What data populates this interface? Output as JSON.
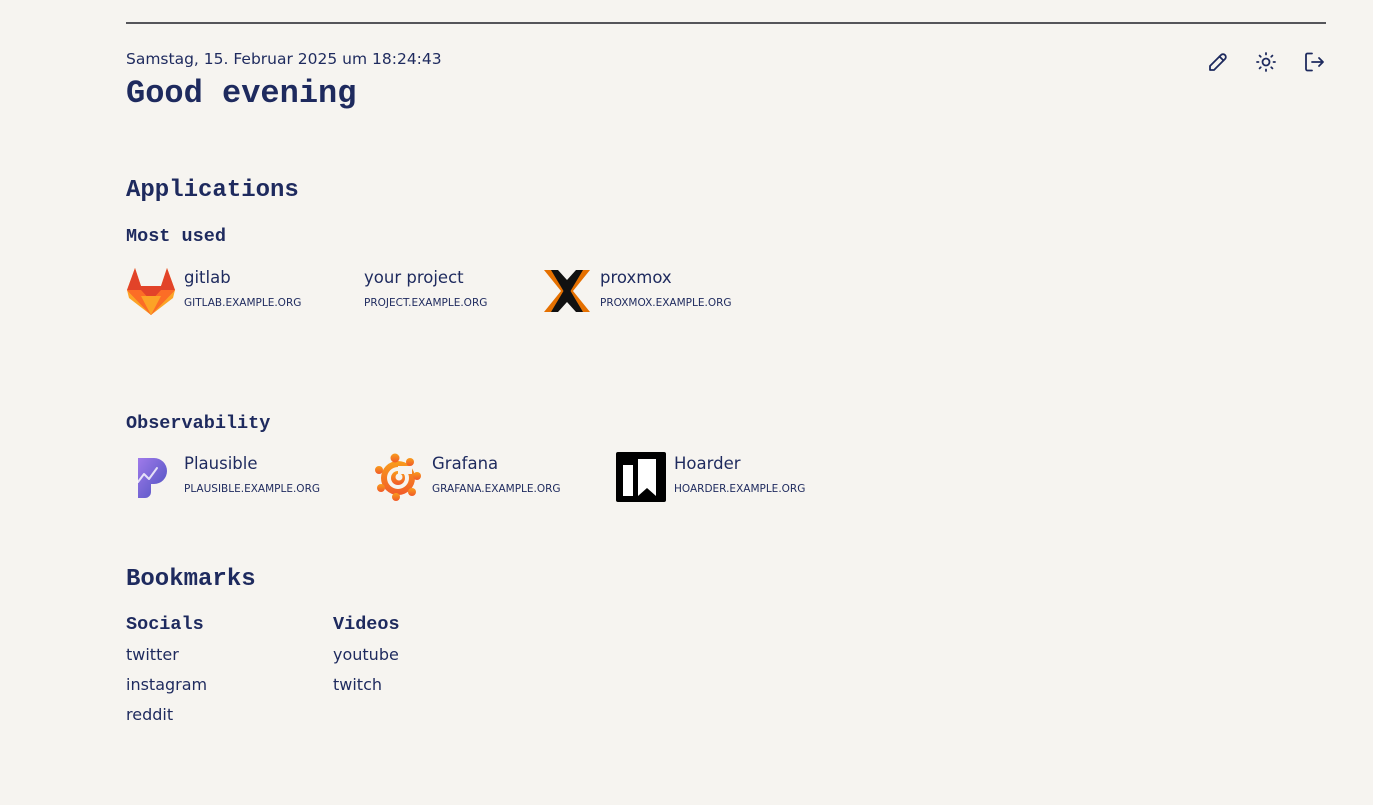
{
  "header": {
    "datetime": "Samstag, 15. Februar 2025 um 18:24:43",
    "greeting": "Good evening",
    "toolbar": {
      "edit_icon": "pencil-icon",
      "theme_icon": "sun-icon",
      "logout_icon": "logout-icon"
    }
  },
  "applications": {
    "title": "Applications",
    "groups": [
      {
        "title": "Most used",
        "apps": [
          {
            "name": "gitlab",
            "url": "GITLAB.EXAMPLE.ORG",
            "icon": "gitlab-icon"
          },
          {
            "name": "your project",
            "url": "PROJECT.EXAMPLE.ORG",
            "icon": ""
          },
          {
            "name": "proxmox",
            "url": "PROXMOX.EXAMPLE.ORG",
            "icon": "proxmox-icon"
          }
        ]
      },
      {
        "title": "Observability",
        "apps": [
          {
            "name": "Plausible",
            "url": "PLAUSIBLE.EXAMPLE.ORG",
            "icon": "plausible-icon"
          },
          {
            "name": "Grafana",
            "url": "GRAFANA.EXAMPLE.ORG",
            "icon": "grafana-icon"
          },
          {
            "name": "Hoarder",
            "url": "HOARDER.EXAMPLE.ORG",
            "icon": "hoarder-icon"
          }
        ]
      }
    ]
  },
  "bookmarks": {
    "title": "Bookmarks",
    "groups": [
      {
        "title": "Socials",
        "links": [
          "twitter",
          "instagram",
          "reddit"
        ]
      },
      {
        "title": "Videos",
        "links": [
          "youtube",
          "twitch"
        ]
      }
    ]
  },
  "colors": {
    "background": "#f6f4f0",
    "text": "#1e2a5e",
    "divider": "#55555a"
  }
}
